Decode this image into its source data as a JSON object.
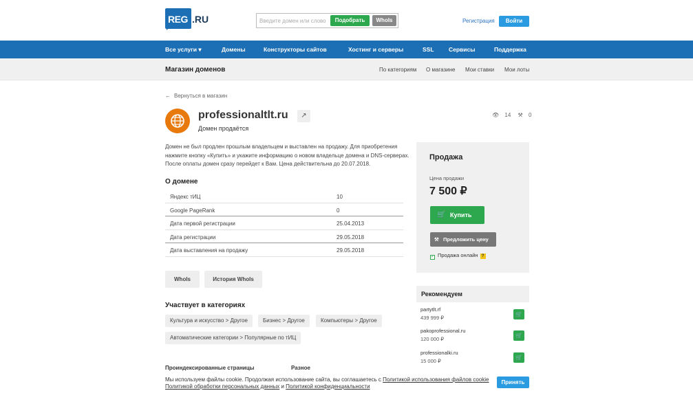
{
  "header": {
    "logo_left": "REG",
    "logo_right": ".RU",
    "search_placeholder": "Введите домен или слово",
    "pick_label": "Подобрать",
    "whois_label": "WhoIs",
    "register_label": "Регистрация",
    "login_label": "Войти"
  },
  "nav": [
    "Все услуги ▾",
    "Домены",
    "Конструкторы сайтов",
    "Хостинг и серверы",
    "SSL",
    "Сервисы",
    "Поддержка"
  ],
  "subbar": {
    "title": "Магазин доменов",
    "links": [
      "По категориям",
      "О магазине",
      "Мои ставки",
      "Мои лоты"
    ]
  },
  "back_label": "Вернуться в магазин",
  "domain": {
    "name": "professionaltlt.ru",
    "ext_icon": "↗",
    "status": "Домен продаётся",
    "views": "14",
    "bids": "0"
  },
  "description": [
    "Домен не был продлен прошлым владельцем и выставлен на продажу. Для приобретения",
    "нажмите кнопку «Купить» и укажите информацию о новом владельце домена и DNS-серверах.",
    "После оплаты домен сразу перейдет к Вам. Цена действительна до 20.07.2018."
  ],
  "about": {
    "title": "О домене",
    "rows": [
      {
        "key": "Яндекс тИЦ",
        "value": "10"
      },
      {
        "key": "Google PageRank",
        "value": "0"
      },
      {
        "key": "Дата первой регистрации",
        "value": "25.04.2013"
      },
      {
        "key": "Дата регистрации",
        "value": "29.05.2018"
      },
      {
        "key": "Дата выставления на продажу",
        "value": "29.05.2018"
      }
    ]
  },
  "actions": {
    "whois": "WhoIs",
    "history": "История WhoIs"
  },
  "categories": {
    "title": "Участвует в категориях",
    "items": [
      "Культура и искусство > Другое",
      "Бизнес > Другое",
      "Компьютеры > Другое",
      "Автоматические категории > Популярные по тИЦ"
    ]
  },
  "sections": {
    "indexed": "Проиндексированные страницы",
    "misc": "Разное"
  },
  "sale": {
    "title": "Продажа",
    "price_label": "Цена продажи",
    "price": "7 500 ₽",
    "buy_label": "Купить",
    "offer_label": "Предложить цену",
    "online_label": "Продажа онлайн",
    "help": "?"
  },
  "recommend": {
    "title": "Рекомендуем",
    "items": [
      {
        "name": "partytlt.rf",
        "price": "439 999 ₽"
      },
      {
        "name": "pakoprofessional.ru",
        "price": "120 000 ₽"
      },
      {
        "name": "professionalki.ru",
        "price": "15 000 ₽"
      }
    ]
  },
  "cookie": {
    "text1": "Мы используем файлы cookie. Продолжая использование сайта, вы соглашаетесь с ",
    "link1": "Политикой использования файлов cookie",
    "link2": "Политикой обработки персональных данных",
    "and": " и ",
    "link3": "Политикой конфиденциальности",
    "accept": "Принять"
  },
  "colors": {
    "brand": "#1c6fb5",
    "green": "#2ea84f",
    "accent_blue": "#2a9be0",
    "orange": "#e8790d"
  }
}
